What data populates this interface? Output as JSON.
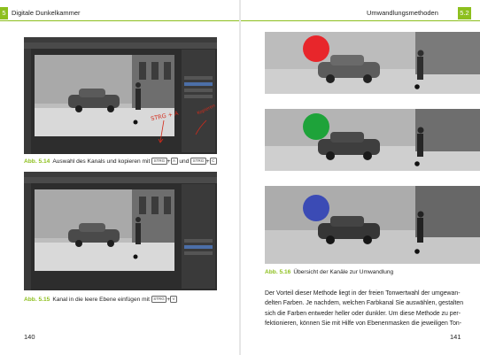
{
  "left_page": {
    "header": {
      "chapter_number": "5",
      "chapter_title": "Digitale Dunkelkammer"
    },
    "figure_514": {
      "label": "Abb. 5.14",
      "text_before": "Auswahl des Kanals und kopieren mit",
      "key1a": "STRG",
      "key1b": "A",
      "conjunction": "und",
      "key2a": "STRG",
      "key2b": "C",
      "annotation_left": "STRG + A",
      "annotation_right": "Kopieren"
    },
    "figure_515": {
      "label": "Abb. 5.15",
      "text_before": "Kanal in die leere Ebene einfügen mit",
      "key1a": "STRG",
      "key1b": "V"
    },
    "page_number": "140"
  },
  "right_page": {
    "header": {
      "section_title": "Umwandlungsmethoden",
      "section_number": "5.2"
    },
    "figure_516": {
      "label": "Abb. 5.16",
      "text": "Übersicht der Kanäle zur Umwandlung",
      "channel_colors": [
        "#e8262b",
        "#1ea33a",
        "#3b4bb5"
      ]
    },
    "body_lines": [
      "Der Vorteil dieser Methode liegt in der freien Tonwertwahl der umgewan-",
      "delten Farben. Je nachdem, welchen Farbkanal Sie auswählen, gestalten",
      "sich die Farben entweder heller oder dunkler. Um diese Methode zu per-",
      "fektionieren, können Sie mit Hilfe von Ebenenmasken die jeweiligen Ton-"
    ],
    "page_number": "141"
  },
  "colors": {
    "accent": "#8dbf1e",
    "annotation": "#d42a1a"
  }
}
